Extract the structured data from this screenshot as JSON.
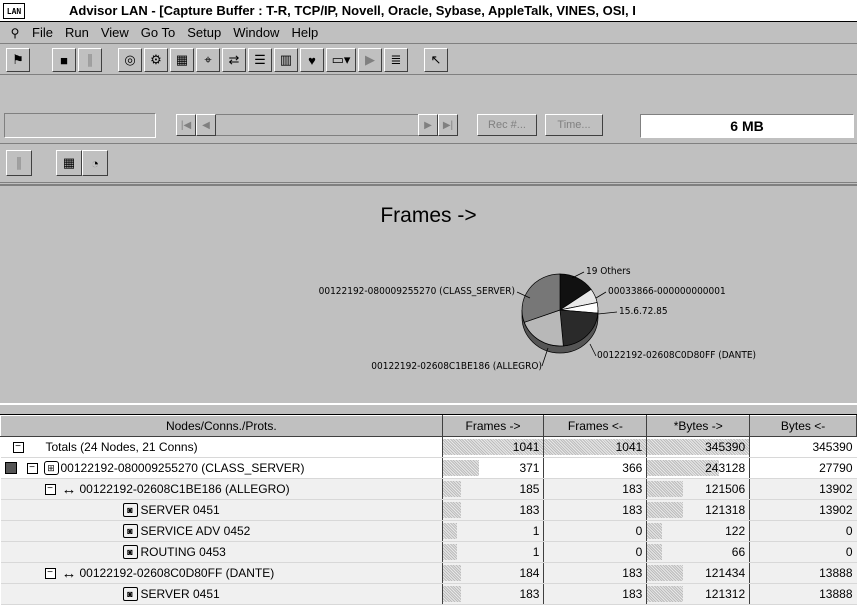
{
  "window": {
    "icon_label": "LAN",
    "title": "Advisor LAN - [Capture Buffer : T-R, TCP/IP, Novell, Oracle, Sybase, AppleTalk, VINES, OSI, I"
  },
  "menu": {
    "items": [
      "File",
      "Run",
      "View",
      "Go To",
      "Setup",
      "Window",
      "Help"
    ]
  },
  "toolbar": {
    "icons": [
      "run-icon",
      "stop-icon",
      "pause-icon",
      "capture-icon",
      "filter-icon",
      "network-icon",
      "nodes-icon",
      "connections-icon",
      "protocols-icon",
      "stats-icon",
      "alarms-icon",
      "dropdown-icon",
      "play-icon",
      "list-icon",
      "pointer-icon"
    ]
  },
  "navigation": {
    "rec_label": "Rec #...",
    "time_label": "Time...",
    "buffer_size": "6 MB"
  },
  "chart_data": {
    "type": "pie",
    "title": "Frames ->",
    "slices": [
      {
        "label": "19 Others",
        "color": "#111111"
      },
      {
        "label": "00033866-000000000001",
        "color": "#e8e8e8"
      },
      {
        "label": "15.6.72.85",
        "color": "#ffffff"
      },
      {
        "label": "00122192-02608C0D80FF (DANTE)",
        "color": "#2a2a2a"
      },
      {
        "label": "00122192-02608C1BE186 (ALLEGRO)",
        "color": "#b8b8b8"
      },
      {
        "label": "00122192-080009255270 (CLASS_SERVER)",
        "color": "#777777"
      }
    ]
  },
  "grid": {
    "columns": [
      "Nodes/Conns./Prots.",
      "Frames ->",
      "Frames <-",
      "*Bytes ->",
      "Bytes <-"
    ],
    "rows": [
      {
        "name": "Totals (24 Nodes, 21 Conns)",
        "type": "totals",
        "values": [
          "1041",
          "1041",
          "345390",
          "345390"
        ],
        "bars": [
          1,
          1,
          1,
          0
        ]
      },
      {
        "name": "00122192-080009255270 (CLASS_SERVER)",
        "type": "node",
        "values": [
          "371",
          "366",
          "243128",
          "27790"
        ],
        "bars": [
          0.36,
          0,
          0.7,
          0
        ]
      },
      {
        "name": "00122192-02608C1BE186 (ALLEGRO)",
        "type": "conn",
        "values": [
          "185",
          "183",
          "121506",
          "13902"
        ],
        "bars": [
          0.18,
          0,
          0.35,
          0
        ]
      },
      {
        "name": "SERVER 0451",
        "type": "proto",
        "values": [
          "183",
          "183",
          "121318",
          "13902"
        ],
        "bars": [
          0.18,
          0,
          0.35,
          0
        ]
      },
      {
        "name": "SERVICE ADV 0452",
        "type": "proto",
        "values": [
          "1",
          "0",
          "122",
          "0"
        ],
        "bars": [
          0,
          0,
          0,
          0
        ]
      },
      {
        "name": "ROUTING 0453",
        "type": "proto",
        "values": [
          "1",
          "0",
          "66",
          "0"
        ],
        "bars": [
          0,
          0,
          0,
          0
        ]
      },
      {
        "name": "00122192-02608C0D80FF (DANTE)",
        "type": "conn",
        "values": [
          "184",
          "183",
          "121434",
          "13888"
        ],
        "bars": [
          0.18,
          0,
          0.35,
          0
        ]
      },
      {
        "name": "SERVER 0451",
        "type": "proto",
        "values": [
          "183",
          "183",
          "121312",
          "13888"
        ],
        "bars": [
          0.18,
          0,
          0.35,
          0
        ]
      }
    ]
  }
}
